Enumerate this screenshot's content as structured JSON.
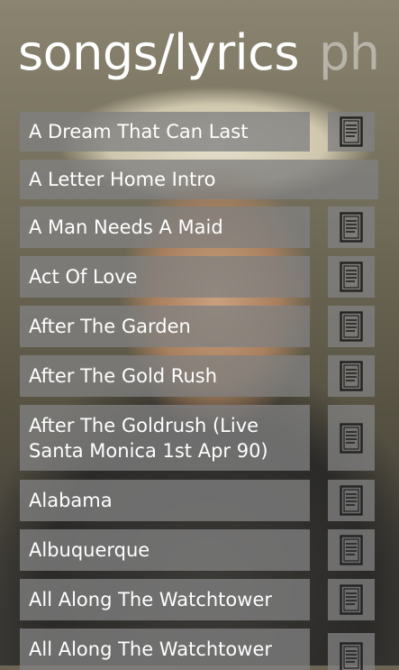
{
  "header": {
    "title": "songs/lyrics",
    "next_pivot": "ph"
  },
  "songs": [
    {
      "title": "A Dream That Can Last",
      "has_lyrics": true
    },
    {
      "title": "A Letter Home Intro",
      "has_lyrics": false
    },
    {
      "title": "A Man Needs A Maid",
      "has_lyrics": true
    },
    {
      "title": "Act Of Love",
      "has_lyrics": true
    },
    {
      "title": "After The Garden",
      "has_lyrics": true
    },
    {
      "title": "After The Gold Rush",
      "has_lyrics": true
    },
    {
      "title": "After The Goldrush (Live Santa Monica 1st Apr 90)",
      "has_lyrics": true
    },
    {
      "title": "Alabama",
      "has_lyrics": true
    },
    {
      "title": "Albuquerque",
      "has_lyrics": true
    },
    {
      "title": "All Along The Watchtower",
      "has_lyrics": true
    },
    {
      "title": "All Along The Watchtower",
      "has_lyrics": true
    }
  ],
  "icons": {
    "lyrics": "lyrics-document-icon"
  }
}
